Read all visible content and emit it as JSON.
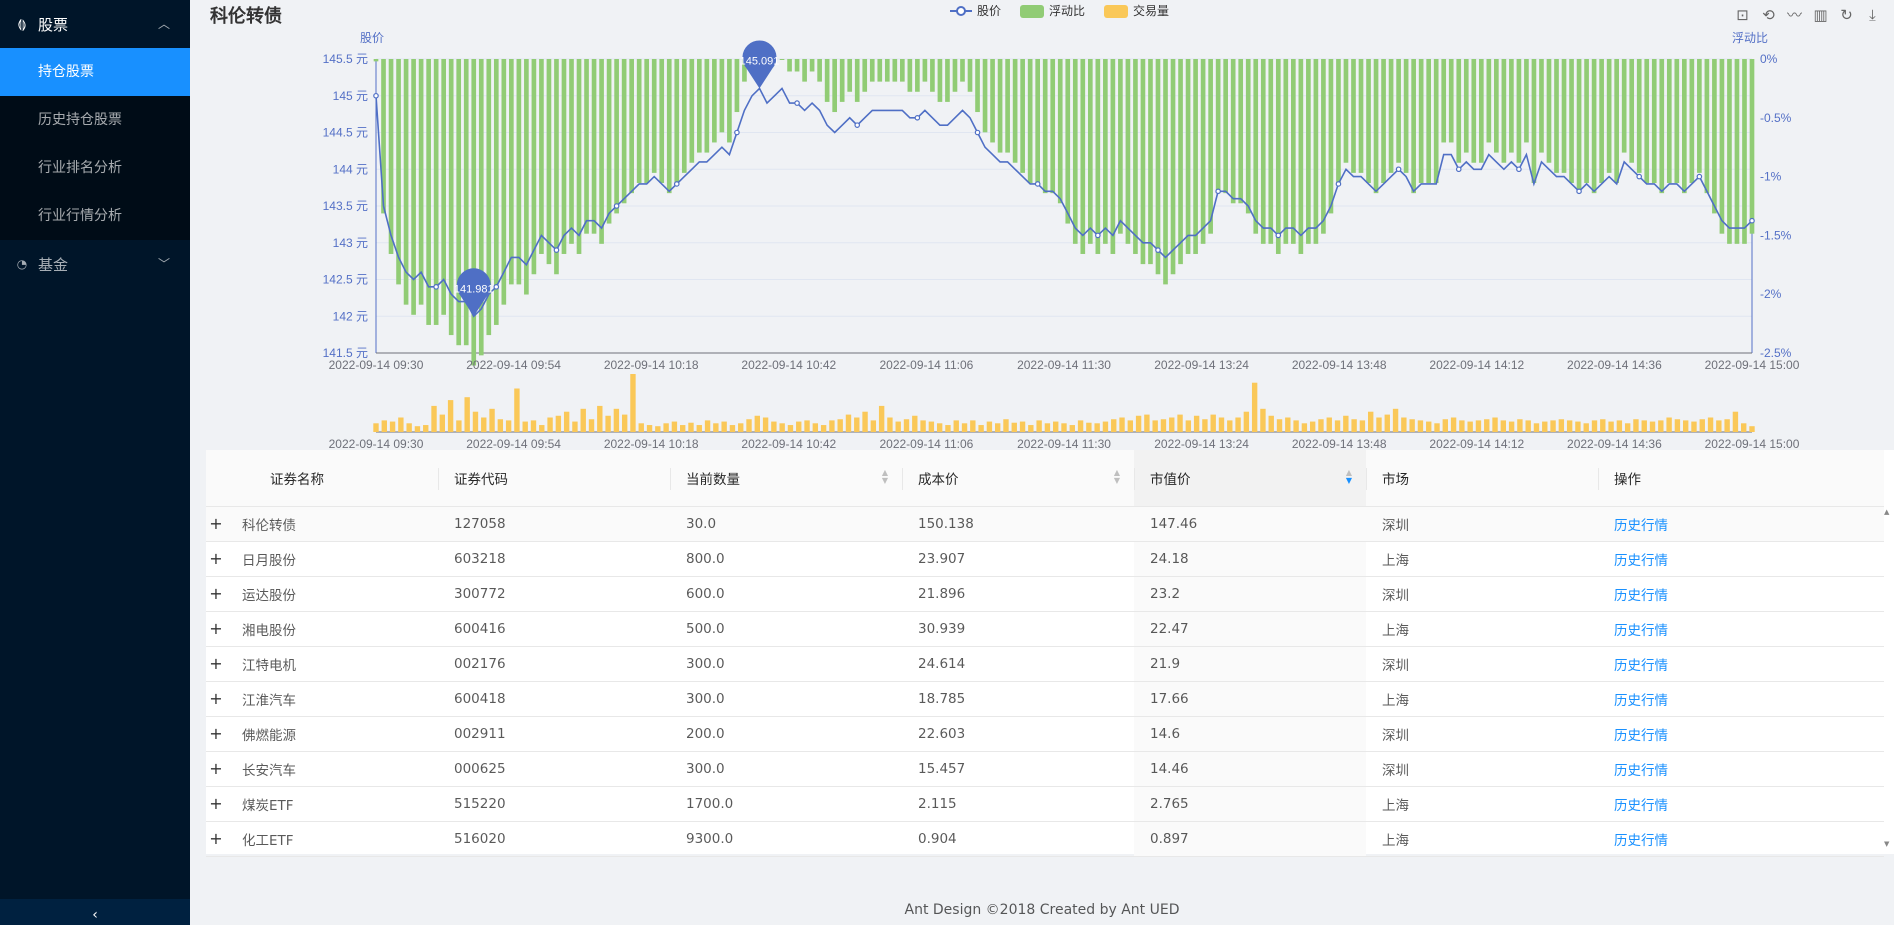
{
  "sidebar": {
    "groups": [
      {
        "label": "股票",
        "expanded": true,
        "items": [
          "持仓股票",
          "历史持仓股票",
          "行业排名分析",
          "行业行情分析"
        ],
        "active": "持仓股票"
      },
      {
        "label": "基金",
        "expanded": false
      }
    ],
    "collapse_icon": "chevron-left-icon"
  },
  "chart_title": "科伦转债",
  "toolbox_icons": [
    "zoom-icon",
    "zoom-reset-icon",
    "line-chart-icon",
    "bar-chart-icon",
    "refresh-icon",
    "download-icon"
  ],
  "chart_data": {
    "type": "line+bar",
    "title": "科伦转债",
    "legend": [
      "股价",
      "浮动比",
      "交易量"
    ],
    "legend_position": "top-center",
    "colors": {
      "price": "#4f6fc5",
      "float": "#91cc75",
      "volume": "#fac858"
    },
    "x_tick_labels": [
      "2022-09-14 09:30",
      "2022-09-14 09:54",
      "2022-09-14 10:18",
      "2022-09-14 10:42",
      "2022-09-14 11:06",
      "2022-09-14 11:30",
      "2022-09-14 13:24",
      "2022-09-14 13:48",
      "2022-09-14 14:12",
      "2022-09-14 14:36",
      "2022-09-14 15:00"
    ],
    "y_left": {
      "label": "股价",
      "unit": "元",
      "min": 141.5,
      "max": 145.5,
      "ticks": [
        "141.5 元",
        "142 元",
        "142.5 元",
        "143 元",
        "143.5 元",
        "144 元",
        "144.5 元",
        "145 元",
        "145.5 元"
      ]
    },
    "y_right": {
      "label": "浮动比",
      "min": -2.5,
      "max": 0,
      "ticks": [
        "-2.5%",
        "-2%",
        "-1.5%",
        "-1%",
        "-0.5%",
        "0%"
      ]
    },
    "price_series": [
      145.0,
      143.5,
      143.1,
      142.8,
      142.6,
      142.5,
      142.6,
      142.4,
      142.4,
      142.5,
      142.3,
      142.2,
      142.2,
      142.0,
      142.1,
      142.3,
      142.4,
      142.6,
      142.8,
      142.8,
      142.7,
      142.9,
      143.1,
      143.0,
      142.9,
      143.1,
      143.2,
      143.1,
      143.3,
      143.3,
      143.2,
      143.4,
      143.5,
      143.6,
      143.7,
      143.8,
      143.8,
      143.9,
      143.8,
      143.7,
      143.8,
      143.9,
      144.0,
      144.1,
      144.1,
      144.2,
      144.3,
      144.2,
      144.5,
      144.8,
      145.0,
      145.1,
      144.9,
      145.0,
      145.1,
      144.9,
      144.9,
      144.8,
      144.9,
      144.8,
      144.6,
      144.5,
      144.6,
      144.7,
      144.6,
      144.7,
      144.8,
      144.8,
      144.8,
      144.8,
      144.8,
      144.7,
      144.7,
      144.8,
      144.7,
      144.6,
      144.6,
      144.7,
      144.8,
      144.7,
      144.5,
      144.3,
      144.2,
      144.1,
      144.1,
      144.0,
      143.9,
      143.8,
      143.8,
      143.7,
      143.7,
      143.6,
      143.4,
      143.2,
      143.1,
      143.2,
      143.1,
      143.2,
      143.1,
      143.3,
      143.2,
      143.1,
      143.0,
      143.0,
      142.9,
      142.8,
      142.9,
      143.0,
      143.1,
      143.1,
      143.2,
      143.3,
      143.7,
      143.7,
      143.6,
      143.6,
      143.5,
      143.3,
      143.2,
      143.2,
      143.1,
      143.2,
      143.2,
      143.1,
      143.2,
      143.2,
      143.3,
      143.5,
      143.8,
      144.0,
      143.9,
      143.9,
      143.8,
      143.7,
      143.8,
      143.9,
      144.0,
      143.9,
      143.7,
      143.8,
      143.8,
      143.8,
      144.2,
      144.2,
      144.0,
      144.1,
      144.0,
      144.0,
      144.2,
      144.1,
      144.0,
      144.1,
      144.0,
      144.2,
      143.8,
      144.1,
      144.0,
      143.9,
      143.9,
      143.8,
      143.7,
      143.8,
      143.7,
      143.8,
      143.9,
      143.8,
      144.1,
      144.0,
      143.9,
      143.8,
      143.8,
      143.7,
      143.8,
      143.8,
      143.7,
      143.8,
      143.9,
      143.7,
      143.5,
      143.3,
      143.2,
      143.2,
      143.2,
      143.3
    ],
    "markers": [
      {
        "label": "145.091",
        "type": "max"
      },
      {
        "label": "141.981",
        "type": "min"
      }
    ],
    "volume_series": [
      0.15,
      0.2,
      0.18,
      0.25,
      0.15,
      0.1,
      0.12,
      0.45,
      0.3,
      0.55,
      0.2,
      0.6,
      0.35,
      0.25,
      0.4,
      0.22,
      0.2,
      0.75,
      0.18,
      0.2,
      0.12,
      0.25,
      0.28,
      0.35,
      0.18,
      0.4,
      0.22,
      0.45,
      0.28,
      0.4,
      0.3,
      1.0,
      0.15,
      0.12,
      0.1,
      0.15,
      0.18,
      0.12,
      0.16,
      0.12,
      0.2,
      0.15,
      0.18,
      0.12,
      0.15,
      0.22,
      0.28,
      0.25,
      0.18,
      0.15,
      0.12,
      0.18,
      0.2,
      0.15,
      0.12,
      0.2,
      0.22,
      0.3,
      0.25,
      0.35,
      0.2,
      0.45,
      0.25,
      0.18,
      0.22,
      0.28,
      0.2,
      0.18,
      0.15,
      0.12,
      0.2,
      0.15,
      0.2,
      0.12,
      0.18,
      0.15,
      0.22,
      0.16,
      0.18,
      0.12,
      0.2,
      0.15,
      0.18,
      0.15,
      0.12,
      0.2,
      0.16,
      0.15,
      0.18,
      0.22,
      0.25,
      0.2,
      0.28,
      0.3,
      0.2,
      0.22,
      0.25,
      0.3,
      0.2,
      0.28,
      0.22,
      0.3,
      0.25,
      0.2,
      0.25,
      0.35,
      0.85,
      0.4,
      0.28,
      0.22,
      0.25,
      0.2,
      0.15,
      0.18,
      0.22,
      0.25,
      0.2,
      0.28,
      0.22,
      0.2,
      0.35,
      0.25,
      0.3,
      0.4,
      0.25,
      0.22,
      0.2,
      0.18,
      0.15,
      0.22,
      0.25,
      0.2,
      0.18,
      0.2,
      0.22,
      0.25,
      0.2,
      0.18,
      0.22,
      0.2,
      0.15,
      0.18,
      0.2,
      0.22,
      0.2,
      0.18,
      0.15,
      0.2,
      0.22,
      0.18,
      0.2,
      0.15,
      0.22,
      0.2,
      0.18,
      0.2,
      0.25,
      0.22,
      0.2,
      0.18,
      0.22,
      0.25,
      0.2,
      0.22,
      0.35,
      0.15,
      0.1
    ]
  },
  "table": {
    "columns": [
      {
        "label": "证券名称",
        "sortable": false
      },
      {
        "label": "证券代码",
        "sortable": false
      },
      {
        "label": "当前数量",
        "sortable": true
      },
      {
        "label": "成本价",
        "sortable": true
      },
      {
        "label": "市值价",
        "sortable": true,
        "sorted": "descend"
      },
      {
        "label": "市场",
        "sortable": false
      },
      {
        "label": "操作",
        "sortable": false
      }
    ],
    "expand_icon": "+",
    "rows": [
      {
        "name": "科伦转债",
        "code": "127058",
        "qty": "30.0",
        "cost": "150.138",
        "value": "147.46",
        "market": "深圳",
        "action": "历史行情"
      },
      {
        "name": "日月股份",
        "code": "603218",
        "qty": "800.0",
        "cost": "23.907",
        "value": "24.18",
        "market": "上海",
        "action": "历史行情"
      },
      {
        "name": "运达股份",
        "code": "300772",
        "qty": "600.0",
        "cost": "21.896",
        "value": "23.2",
        "market": "深圳",
        "action": "历史行情"
      },
      {
        "name": "湘电股份",
        "code": "600416",
        "qty": "500.0",
        "cost": "30.939",
        "value": "22.47",
        "market": "上海",
        "action": "历史行情"
      },
      {
        "name": "江特电机",
        "code": "002176",
        "qty": "300.0",
        "cost": "24.614",
        "value": "21.9",
        "market": "深圳",
        "action": "历史行情"
      },
      {
        "name": "江淮汽车",
        "code": "600418",
        "qty": "300.0",
        "cost": "18.785",
        "value": "17.66",
        "market": "上海",
        "action": "历史行情"
      },
      {
        "name": "佛燃能源",
        "code": "002911",
        "qty": "200.0",
        "cost": "22.603",
        "value": "14.6",
        "market": "深圳",
        "action": "历史行情"
      },
      {
        "name": "长安汽车",
        "code": "000625",
        "qty": "300.0",
        "cost": "15.457",
        "value": "14.46",
        "market": "深圳",
        "action": "历史行情"
      },
      {
        "name": "煤炭ETF",
        "code": "515220",
        "qty": "1700.0",
        "cost": "2.115",
        "value": "2.765",
        "market": "上海",
        "action": "历史行情"
      },
      {
        "name": "化工ETF",
        "code": "516020",
        "qty": "9300.0",
        "cost": "0.904",
        "value": "0.897",
        "market": "上海",
        "action": "历史行情"
      }
    ]
  },
  "footer": "Ant Design ©2018 Created by Ant UED"
}
